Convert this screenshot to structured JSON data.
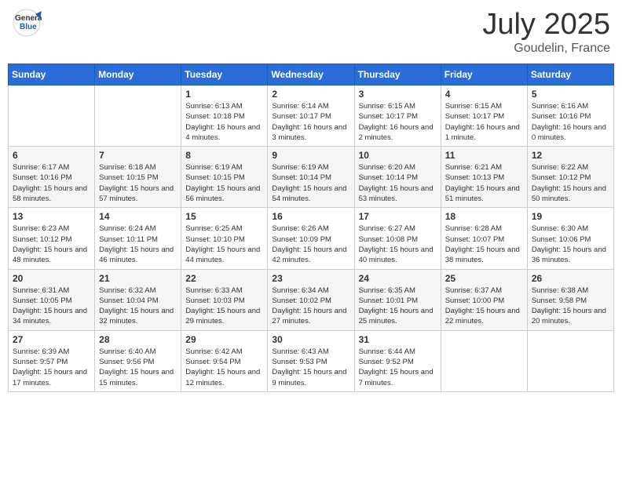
{
  "logo": {
    "general": "General",
    "blue": "Blue"
  },
  "title": "July 2025",
  "location": "Goudelin, France",
  "days_of_week": [
    "Sunday",
    "Monday",
    "Tuesday",
    "Wednesday",
    "Thursday",
    "Friday",
    "Saturday"
  ],
  "weeks": [
    [
      {
        "day": "",
        "info": ""
      },
      {
        "day": "",
        "info": ""
      },
      {
        "day": "1",
        "info": "Sunrise: 6:13 AM\nSunset: 10:18 PM\nDaylight: 16 hours\nand 4 minutes."
      },
      {
        "day": "2",
        "info": "Sunrise: 6:14 AM\nSunset: 10:17 PM\nDaylight: 16 hours\nand 3 minutes."
      },
      {
        "day": "3",
        "info": "Sunrise: 6:15 AM\nSunset: 10:17 PM\nDaylight: 16 hours\nand 2 minutes."
      },
      {
        "day": "4",
        "info": "Sunrise: 6:15 AM\nSunset: 10:17 PM\nDaylight: 16 hours\nand 1 minute."
      },
      {
        "day": "5",
        "info": "Sunrise: 6:16 AM\nSunset: 10:16 PM\nDaylight: 16 hours\nand 0 minutes."
      }
    ],
    [
      {
        "day": "6",
        "info": "Sunrise: 6:17 AM\nSunset: 10:16 PM\nDaylight: 15 hours\nand 58 minutes."
      },
      {
        "day": "7",
        "info": "Sunrise: 6:18 AM\nSunset: 10:15 PM\nDaylight: 15 hours\nand 57 minutes."
      },
      {
        "day": "8",
        "info": "Sunrise: 6:19 AM\nSunset: 10:15 PM\nDaylight: 15 hours\nand 56 minutes."
      },
      {
        "day": "9",
        "info": "Sunrise: 6:19 AM\nSunset: 10:14 PM\nDaylight: 15 hours\nand 54 minutes."
      },
      {
        "day": "10",
        "info": "Sunrise: 6:20 AM\nSunset: 10:14 PM\nDaylight: 15 hours\nand 53 minutes."
      },
      {
        "day": "11",
        "info": "Sunrise: 6:21 AM\nSunset: 10:13 PM\nDaylight: 15 hours\nand 51 minutes."
      },
      {
        "day": "12",
        "info": "Sunrise: 6:22 AM\nSunset: 10:12 PM\nDaylight: 15 hours\nand 50 minutes."
      }
    ],
    [
      {
        "day": "13",
        "info": "Sunrise: 6:23 AM\nSunset: 10:12 PM\nDaylight: 15 hours\nand 48 minutes."
      },
      {
        "day": "14",
        "info": "Sunrise: 6:24 AM\nSunset: 10:11 PM\nDaylight: 15 hours\nand 46 minutes."
      },
      {
        "day": "15",
        "info": "Sunrise: 6:25 AM\nSunset: 10:10 PM\nDaylight: 15 hours\nand 44 minutes."
      },
      {
        "day": "16",
        "info": "Sunrise: 6:26 AM\nSunset: 10:09 PM\nDaylight: 15 hours\nand 42 minutes."
      },
      {
        "day": "17",
        "info": "Sunrise: 6:27 AM\nSunset: 10:08 PM\nDaylight: 15 hours\nand 40 minutes."
      },
      {
        "day": "18",
        "info": "Sunrise: 6:28 AM\nSunset: 10:07 PM\nDaylight: 15 hours\nand 38 minutes."
      },
      {
        "day": "19",
        "info": "Sunrise: 6:30 AM\nSunset: 10:06 PM\nDaylight: 15 hours\nand 36 minutes."
      }
    ],
    [
      {
        "day": "20",
        "info": "Sunrise: 6:31 AM\nSunset: 10:05 PM\nDaylight: 15 hours\nand 34 minutes."
      },
      {
        "day": "21",
        "info": "Sunrise: 6:32 AM\nSunset: 10:04 PM\nDaylight: 15 hours\nand 32 minutes."
      },
      {
        "day": "22",
        "info": "Sunrise: 6:33 AM\nSunset: 10:03 PM\nDaylight: 15 hours\nand 29 minutes."
      },
      {
        "day": "23",
        "info": "Sunrise: 6:34 AM\nSunset: 10:02 PM\nDaylight: 15 hours\nand 27 minutes."
      },
      {
        "day": "24",
        "info": "Sunrise: 6:35 AM\nSunset: 10:01 PM\nDaylight: 15 hours\nand 25 minutes."
      },
      {
        "day": "25",
        "info": "Sunrise: 6:37 AM\nSunset: 10:00 PM\nDaylight: 15 hours\nand 22 minutes."
      },
      {
        "day": "26",
        "info": "Sunrise: 6:38 AM\nSunset: 9:58 PM\nDaylight: 15 hours\nand 20 minutes."
      }
    ],
    [
      {
        "day": "27",
        "info": "Sunrise: 6:39 AM\nSunset: 9:57 PM\nDaylight: 15 hours\nand 17 minutes."
      },
      {
        "day": "28",
        "info": "Sunrise: 6:40 AM\nSunset: 9:56 PM\nDaylight: 15 hours\nand 15 minutes."
      },
      {
        "day": "29",
        "info": "Sunrise: 6:42 AM\nSunset: 9:54 PM\nDaylight: 15 hours\nand 12 minutes."
      },
      {
        "day": "30",
        "info": "Sunrise: 6:43 AM\nSunset: 9:53 PM\nDaylight: 15 hours\nand 9 minutes."
      },
      {
        "day": "31",
        "info": "Sunrise: 6:44 AM\nSunset: 9:52 PM\nDaylight: 15 hours\nand 7 minutes."
      },
      {
        "day": "",
        "info": ""
      },
      {
        "day": "",
        "info": ""
      }
    ]
  ]
}
